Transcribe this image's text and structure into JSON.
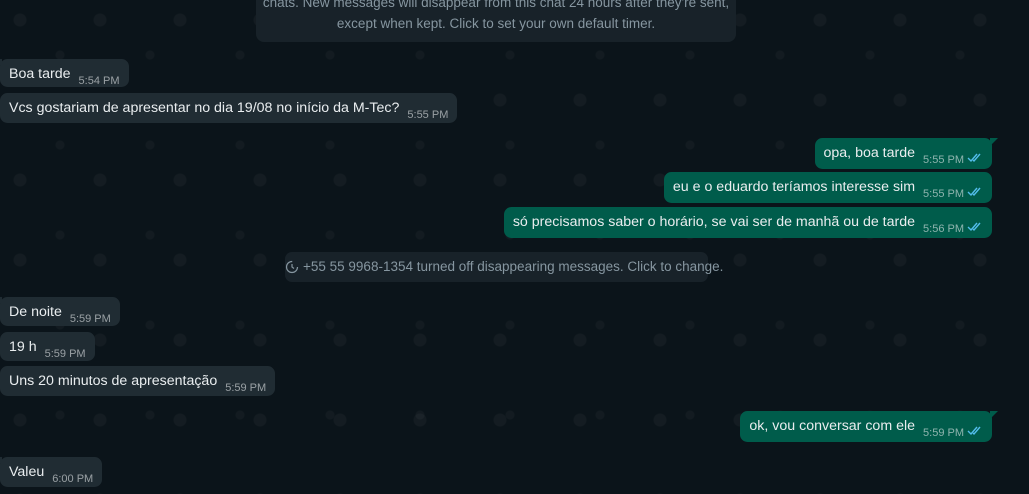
{
  "top_notice": {
    "line1": "chats. New messages will disappear from this chat 24 hours after they're sent,",
    "line2": "except when kept. Click to set your own default timer."
  },
  "messages": [
    {
      "dir": "in",
      "text": "Boa tarde",
      "time": "5:54 PM"
    },
    {
      "dir": "in",
      "text": "Vcs gostariam de apresentar no dia 19/08 no início da M-Tec?",
      "time": "5:55 PM"
    },
    {
      "dir": "out",
      "text": "opa, boa tarde",
      "time": "5:55 PM",
      "status_icon": "double-check-icon"
    },
    {
      "dir": "out",
      "text": "eu e o eduardo teríamos interesse sim",
      "time": "5:55 PM",
      "status_icon": "double-check-icon"
    },
    {
      "dir": "out",
      "text": "só precisamos saber o horário, se vai ser de manhã ou de tarde",
      "time": "5:56 PM",
      "status_icon": "double-check-icon"
    },
    {
      "dir": "in",
      "text": "De noite",
      "time": "5:59 PM"
    },
    {
      "dir": "in",
      "text": "19 h",
      "time": "5:59 PM"
    },
    {
      "dir": "in",
      "text": "Uns 20 minutos de apresentação",
      "time": "5:59 PM"
    },
    {
      "dir": "out",
      "text": "ok, vou conversar com ele",
      "time": "5:59 PM",
      "status_icon": "double-check-icon"
    },
    {
      "dir": "in",
      "text": "Valeu",
      "time": "6:00 PM"
    }
  ],
  "disappearing_notice": {
    "icon": "timer-off-icon",
    "text": "+55 55 9968-1354 turned off disappearing messages. Click to change."
  },
  "colors": {
    "background": "#0b141a",
    "incoming_bubble": "#202c33",
    "outgoing_bubble": "#005c4b",
    "read_ticks": "#53bdeb",
    "meta_text": "#8696a0"
  }
}
